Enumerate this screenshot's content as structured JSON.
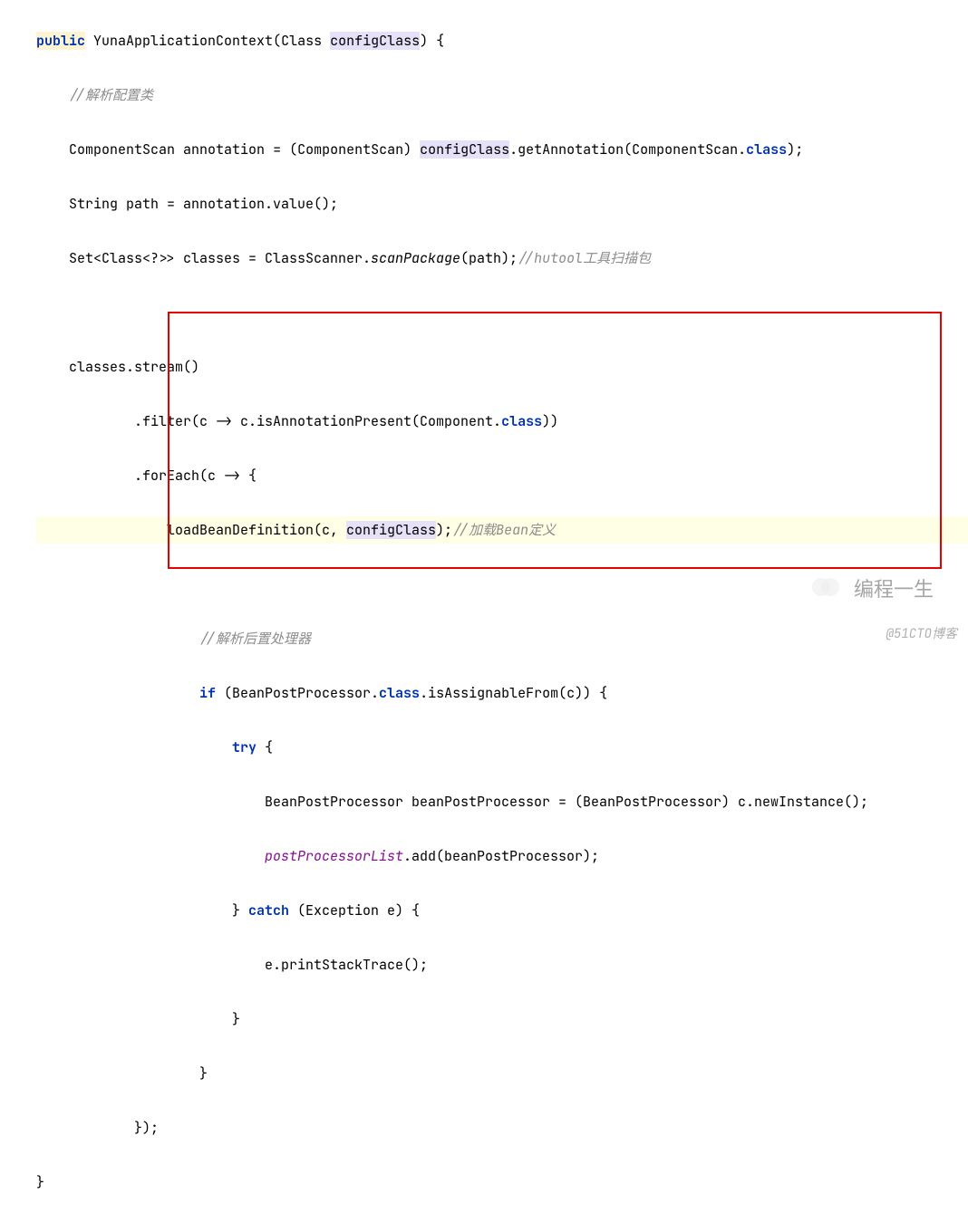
{
  "code": {
    "l1_kw_public": "public",
    "l1_class": "YunaApplicationContext",
    "l1_paramtype": "Class",
    "l1_param": "configClass",
    "l1_brace_open": ") {",
    "l2_comment": "//解析配置类",
    "l3_type": "ComponentScan",
    "l3_var": "annotation",
    "l3_eq": " = (",
    "l3_cast": "ComponentScan",
    "l3_cast_close": ") ",
    "l3_target": "configClass",
    "l3_call": ".getAnnotation(",
    "l3_arg": "ComponentScan",
    "l3_class_kw": "class",
    "l3_end": ");",
    "l4": "String path = annotation.value();",
    "l5_pre": "Set<Class<?>> classes = ClassScanner.",
    "l5_static": "scanPackage",
    "l5_post": "(path);",
    "l5_comment": "//hutool工具扫描包",
    "l7": "classes.stream()",
    "l8_pre": ".filter(c -> c.isAnnotationPresent(",
    "l8_type": "Component",
    "l8_class_kw": "class",
    "l8_post": "))",
    "l9": ".forEach(c -> {",
    "l10_pre": "loadBeanDefinition(c, ",
    "l10_param": "configClass",
    "l10_post": ");",
    "l10_comment": "//加载Bean定义",
    "l12_comment": "//解析后置处理器",
    "l13_if": "if",
    "l13_pre": " (BeanPostProcessor.",
    "l13_class_kw": "class",
    "l13_post": ".isAssignableFrom(c)) {",
    "l14_try": "try",
    "l14_brace": " {",
    "l15": "BeanPostProcessor beanPostProcessor = (BeanPostProcessor) c.newInstance();",
    "l16_field": "postProcessorList",
    "l16_post": ".add(beanPostProcessor);",
    "l17_close": "} ",
    "l17_catch": "catch",
    "l17_post": " (Exception e) {",
    "l18": "e.printStackTrace();",
    "l19": "}",
    "l20": "}",
    "l21": "});",
    "l22": "}"
  },
  "watermark": {
    "text": "编程一生",
    "caption": "@51CTO博客"
  }
}
